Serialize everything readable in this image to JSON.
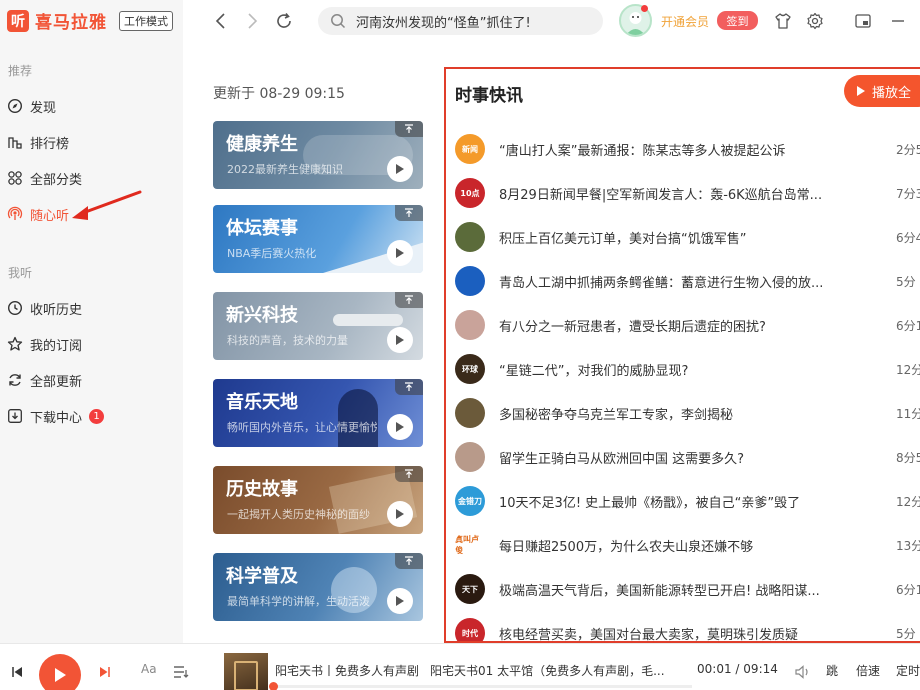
{
  "app": {
    "logo_text": "喜马拉雅",
    "mode_badge": "工作模式",
    "brand_color": "#f25436"
  },
  "sidebar": {
    "recommend_title": "推荐",
    "recommend_items": [
      {
        "label": "发现",
        "icon": "compass-icon"
      },
      {
        "label": "排行榜",
        "icon": "chart-icon"
      },
      {
        "label": "全部分类",
        "icon": "grid-icon"
      },
      {
        "label": "随心听",
        "icon": "radio-icon",
        "active": true
      }
    ],
    "mine_title": "我听",
    "mine_items": [
      {
        "label": "收听历史",
        "icon": "clock-icon"
      },
      {
        "label": "我的订阅",
        "icon": "star-icon"
      },
      {
        "label": "全部更新",
        "icon": "refresh-icon"
      },
      {
        "label": "下载中心",
        "icon": "download-icon",
        "badge": "1"
      }
    ]
  },
  "topbar": {
    "search_value": "河南汝州发现的“怪鱼”抓住了!",
    "vip_label": "开通会员",
    "signin_label": "签到",
    "icons": [
      "back-arrow-icon",
      "forward-arrow-icon",
      "reload-icon",
      "search-icon",
      "tshirt-icon",
      "gear-icon",
      "mini-window-icon"
    ]
  },
  "main": {
    "update_time": "更新于 08-29 09:15",
    "categories": [
      {
        "title": "健康养生",
        "subtitle": "2022最新养生健康知识",
        "color": "#5b7a95"
      },
      {
        "title": "体坛赛事",
        "subtitle": "NBA季后赛火热化",
        "color": "#3a82c4"
      },
      {
        "title": "新兴科技",
        "subtitle": "科技的声音，技术的力量",
        "color": "#8fa0b0"
      },
      {
        "title": "音乐天地",
        "subtitle": "畅听国内外音乐，让心情更愉悦",
        "color": "#3250a3"
      },
      {
        "title": "历史故事",
        "subtitle": "一起揭开人类历史神秘的面纱",
        "color": "#8a5a38"
      },
      {
        "title": "科学普及",
        "subtitle": "最简单科学的讲解，生动活泼",
        "color": "#3a6c9c"
      }
    ]
  },
  "news": {
    "title": "时事快讯",
    "play_all_label": "播放全",
    "items": [
      {
        "text": "“唐山打人案”最新通报：陈某志等多人被提起公诉",
        "duration": "2分5",
        "thumb_color": "#f49a2a",
        "thumb_text": "新闻"
      },
      {
        "text": "8月29日新闻早餐|空军新闻发言人：轰-6K巡航台岛常...",
        "duration": "7分3",
        "thumb_color": "#c9262b",
        "thumb_text": "10点"
      },
      {
        "text": "积压上百亿美元订单，美对台搞“饥饿军售”",
        "duration": "6分4",
        "thumb_color": "#5b6b3a",
        "thumb_text": ""
      },
      {
        "text": "青岛人工湖中抓捕两条鳄雀鳝：蓄意进行生物入侵的放...",
        "duration": "5分",
        "thumb_color": "#1b5fbf",
        "thumb_text": ""
      },
      {
        "text": "有八分之一新冠患者，遭受长期后遗症的困扰?",
        "duration": "6分1",
        "thumb_color": "#c9a39a",
        "thumb_text": ""
      },
      {
        "text": "“星链二代”，对我们的威胁显现?",
        "duration": "12分3",
        "thumb_color": "#3a2a1a",
        "thumb_text": "环球"
      },
      {
        "text": "多国秘密争夺乌克兰军工专家，李剑揭秘",
        "duration": "11分3",
        "thumb_color": "#6b5a3a",
        "thumb_text": ""
      },
      {
        "text": "留学生正骑白马从欧洲回中国 这需要多久?",
        "duration": "8分5",
        "thumb_color": "#b89a8a",
        "thumb_text": ""
      },
      {
        "text": "10天不足3亿! 史上最帅《杨戬》，被自己“亲爹”毁了",
        "duration": "12分3",
        "thumb_color": "#2d9bd8",
        "thumb_text": "金错刀"
      },
      {
        "text": "每日赚超2500万，为什么农夫山泉还嫌不够",
        "duration": "13分4",
        "thumb_color": "#ffffff",
        "thumb_text": "真叫卢俊"
      },
      {
        "text": "极端高温天气背后，美国新能源转型已开启! 战略阳谋...",
        "duration": "6分1",
        "thumb_color": "#2a1a10",
        "thumb_text": "天下"
      },
      {
        "text": "核电经营买卖，美国对台最大卖家，莫明珠引发质疑",
        "duration": "5分",
        "thumb_color": "#c9262b",
        "thumb_text": "时代"
      }
    ]
  },
  "player": {
    "track_title": "阳宅天书丨免费多人有声剧",
    "episode": "阳宅天书01 太平馆（免费多人有声剧，毛...",
    "time_current": "00:01",
    "time_total": "09:14",
    "time_separator": "/",
    "progress": 0.002,
    "skip_label": "跳",
    "speed_label": "倍速",
    "timer_label": "定时",
    "font_label": "Aa"
  }
}
